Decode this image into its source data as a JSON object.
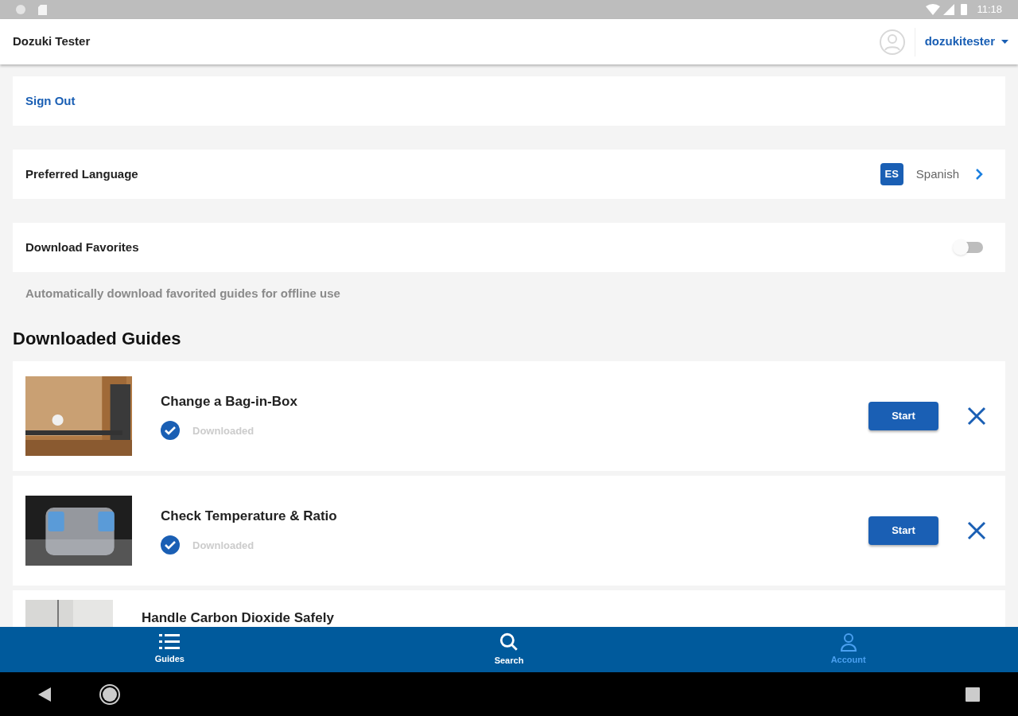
{
  "status_bar": {
    "time": "11:18"
  },
  "header": {
    "title": "Dozuki Tester",
    "user": "dozukitester"
  },
  "sign_out": "Sign Out",
  "language": {
    "label": "Preferred Language",
    "code": "ES",
    "value": "Spanish"
  },
  "download_favorites": {
    "label": "Download Favorites",
    "on": false,
    "hint": "Automatically download favorited guides for offline use"
  },
  "section_title": "Downloaded Guides",
  "guides": [
    {
      "title": "Change a Bag-in-Box",
      "status": "Downloaded",
      "downloaded": true,
      "button": "Start"
    },
    {
      "title": "Check Temperature & Ratio",
      "status": "Downloaded",
      "downloaded": true,
      "button": "Start"
    },
    {
      "title": "Handle Carbon Dioxide Safely"
    }
  ],
  "tabs": [
    {
      "label": "Guides",
      "selected": false
    },
    {
      "label": "Search",
      "selected": false
    },
    {
      "label": "Account",
      "selected": true
    }
  ]
}
